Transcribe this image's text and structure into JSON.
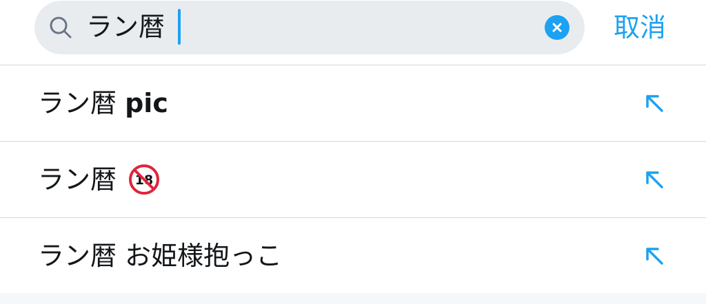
{
  "search": {
    "query": "ラン暦",
    "cancel_label": "取消"
  },
  "suggestions": [
    {
      "prefix": "ラン暦",
      "suffix": "pic",
      "suffix_style": "bold"
    },
    {
      "prefix": "ラン暦",
      "suffix": "",
      "emoji": "no-one-under-eighteen-icon"
    },
    {
      "prefix": "ラン暦",
      "suffix": "お姫様抱っこ",
      "suffix_style": "normal"
    }
  ],
  "colors": {
    "accent": "#1da1f2",
    "field_bg": "#e9ecef",
    "divider": "#d2d6da",
    "text": "#14171a"
  }
}
